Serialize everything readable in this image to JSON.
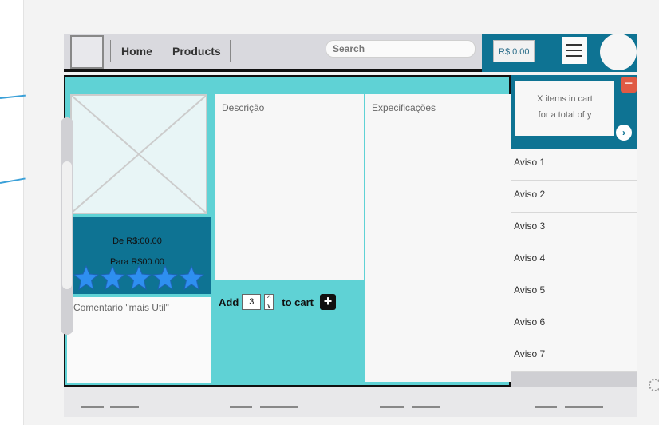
{
  "header": {
    "nav": [
      "Home",
      "Products"
    ],
    "search_placeholder": "Search",
    "cart_total": "R$ 0.00"
  },
  "product": {
    "description_label": "Descrição",
    "specs_label": "Expecificações",
    "price_from": "De R$:00.00",
    "price_to": "Para R$00.00",
    "rating": 5,
    "rating_max": 5,
    "comment_label": "Comentario \"mais Util\"",
    "add_label": "Add",
    "quantity": "3",
    "to_cart_label": "to cart"
  },
  "cart": {
    "line1": "X items in cart",
    "line2": "for a total of y"
  },
  "notices": [
    "Aviso 1",
    "Aviso 2",
    "Aviso 3",
    "Aviso 4",
    "Aviso 5",
    "Aviso 6",
    "Aviso 7"
  ],
  "colors": {
    "teal": "#5fd2d5",
    "dark_teal": "#0e7393",
    "star": "#2e8ff0",
    "remove_red": "#e05a44"
  }
}
